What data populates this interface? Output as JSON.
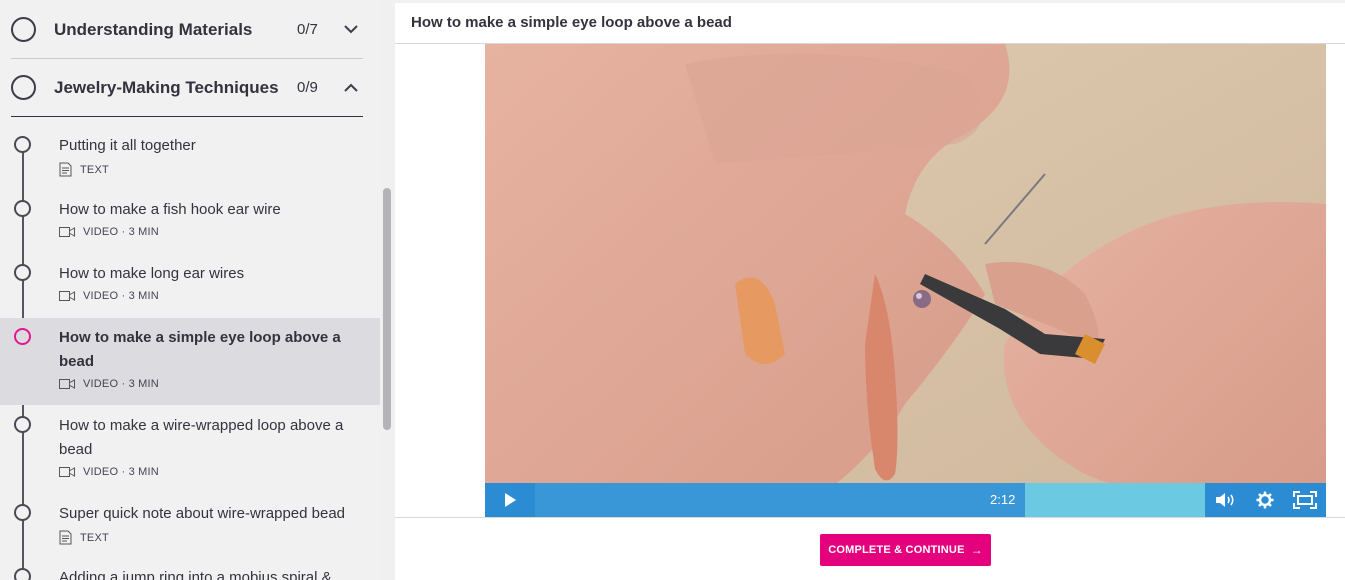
{
  "sidebar": {
    "sections": [
      {
        "title": "Understanding Materials",
        "count": "0/7",
        "state": "collapsed",
        "chevron": "chevron-down-icon"
      },
      {
        "title": "Jewelry-Making Techniques",
        "count": "0/9",
        "state": "expanded",
        "chevron": "chevron-up-icon"
      }
    ],
    "lessons": [
      {
        "title": "Putting it all together",
        "type_icon": "document-icon",
        "meta": "TEXT",
        "active": false
      },
      {
        "title": "How to make a fish hook ear wire",
        "type_icon": "video-camera-icon",
        "meta": "VIDEO · 3 MIN",
        "active": false
      },
      {
        "title": "How to make long ear wires",
        "type_icon": "video-camera-icon",
        "meta": "VIDEO · 3 MIN",
        "active": false
      },
      {
        "title": "How to make a simple eye loop above a bead",
        "type_icon": "video-camera-icon",
        "meta": "VIDEO · 3 MIN",
        "active": true
      },
      {
        "title": "How to make a wire-wrapped loop above a bead",
        "type_icon": "video-camera-icon",
        "meta": "VIDEO · 3 MIN",
        "active": false
      },
      {
        "title": "Super quick note about wire-wrapped bead",
        "type_icon": "document-icon",
        "meta": "TEXT",
        "active": false
      },
      {
        "title": "Adding a jump ring into a mobius spiral &",
        "type_icon": "",
        "meta": "",
        "active": false
      }
    ]
  },
  "main": {
    "lesson_title": "How to make a simple eye loop above a bead",
    "video": {
      "time": "2:12",
      "progress_fraction": 0.58,
      "play_icon": "play-icon",
      "volume_icon": "volume-icon",
      "settings_icon": "gear-icon",
      "fullscreen_icon": "fullscreen-icon"
    },
    "complete_button": {
      "label": "COMPLETE & CONTINUE",
      "arrow": "→"
    }
  },
  "colors": {
    "accent": "#e5007e",
    "active_dot": "#e5178d",
    "video_controls": "#3a96d7"
  }
}
